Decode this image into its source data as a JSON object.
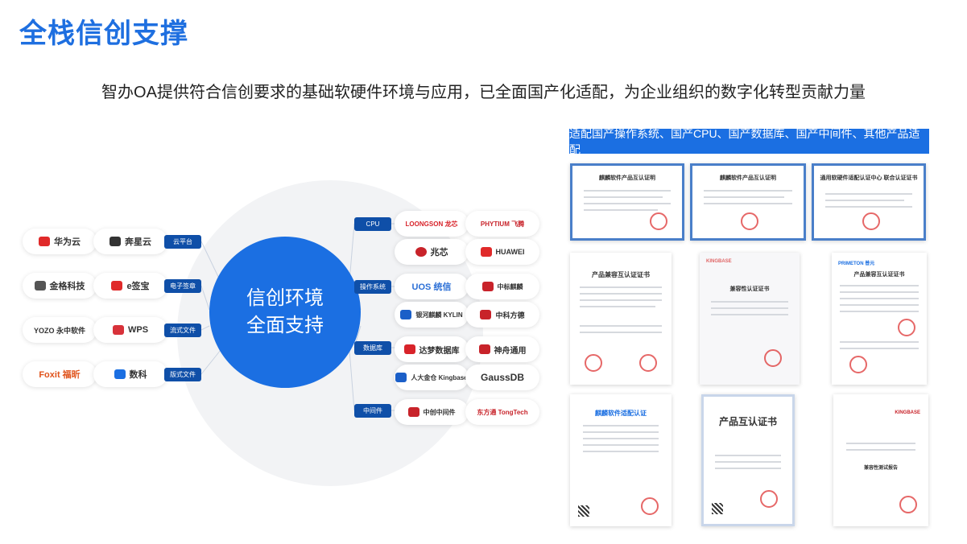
{
  "title": "全栈信创支撑",
  "subtitle": "智办OA提供符合信创要求的基础软硬件环境与应用，已全面国产化适配，为企业组织的数字化转型贡献力量",
  "core": {
    "line1": "信创环境",
    "line2": "全面支持"
  },
  "left_tags": [
    "云平台",
    "电子签章",
    "流式文件",
    "版式文件"
  ],
  "left_logos": [
    {
      "a": "华为云",
      "b": "奔星云"
    },
    {
      "a": "金格科技",
      "b": "e签宝"
    },
    {
      "a": "YOZO 永中软件",
      "b": "WPS"
    },
    {
      "a": "Foxit 福昕",
      "b": "数科"
    }
  ],
  "right_tags": [
    "CPU",
    "操作系统",
    "数据库",
    "中间件"
  ],
  "right_logos": [
    {
      "a": "LOONGSON 龙芯",
      "b": "PHYTIUM 飞腾"
    },
    {
      "a": "兆芯",
      "b": "HUAWEI"
    },
    {
      "a": "UOS 统信",
      "b": "中标麒麟"
    },
    {
      "a": "银河麒麟 KYLIN",
      "b": "中科方德"
    },
    {
      "a": "达梦数据库",
      "b": "神舟通用"
    },
    {
      "a": "人大金仓 Kingbase",
      "b": "GaussDB"
    },
    {
      "a": "中创中间件",
      "b": "东方通 TongTech"
    }
  ],
  "banner": "适配国产操作系统、国产CPU、国产数据库、国产中间件、其他产品适配",
  "certs": [
    {
      "title": "麒麟软件产品互认证明"
    },
    {
      "title": "麒麟软件产品互认证明"
    },
    {
      "title": "通用软硬件适配认证中心 联合认证证书"
    },
    {
      "title": "产品兼容互认证证书"
    },
    {
      "title": "兼容性认证证书",
      "logo": "KINGBASE"
    },
    {
      "title": "产品兼容互认证证书",
      "logo": "PRIMETON 普元"
    },
    {
      "title": "麒麟软件适配认证"
    },
    {
      "title": "产品互认证书"
    },
    {
      "title": "兼容性测试报告",
      "logo": "KINGBASE"
    }
  ],
  "colors": {
    "brand_blue": "#1e6fe0",
    "tag_navy": "#0f4fa8",
    "circle_bg": "#f2f3f5"
  }
}
